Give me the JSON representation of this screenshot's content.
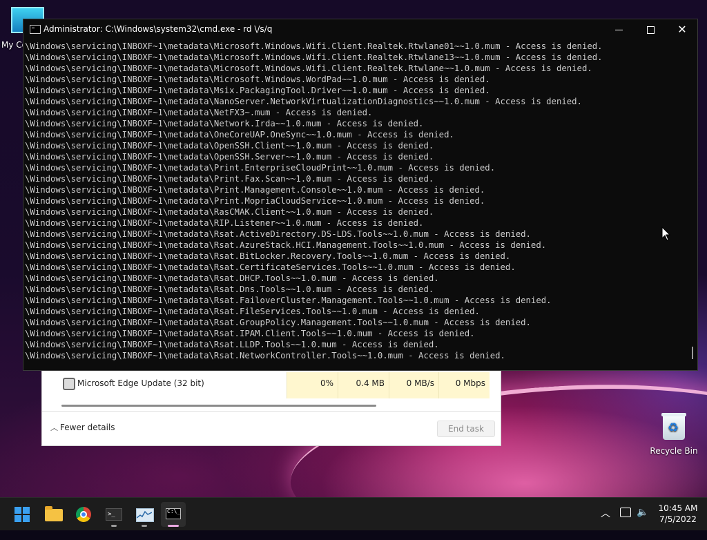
{
  "desktop": {
    "my_computer_label": "My Co",
    "recycle_bin_label": "Recycle Bin"
  },
  "task_manager": {
    "process_name": "Microsoft Edge Update (32 bit)",
    "cpu": "0%",
    "memory": "0.4 MB",
    "disk": "0 MB/s",
    "network": "0 Mbps",
    "fewer_details_label": "Fewer details",
    "end_task_label": "End task"
  },
  "cmd_window": {
    "title": "Administrator: C:\\Windows\\system32\\cmd.exe - rd \\/s/q",
    "lines": [
      "\\Windows\\servicing\\INBOXF~1\\metadata\\Microsoft.Windows.Wifi.Client.Realtek.Rtwlane01~~1.0.mum - Access is denied.",
      "\\Windows\\servicing\\INBOXF~1\\metadata\\Microsoft.Windows.Wifi.Client.Realtek.Rtwlane13~~1.0.mum - Access is denied.",
      "\\Windows\\servicing\\INBOXF~1\\metadata\\Microsoft.Windows.Wifi.Client.Realtek.Rtwlane~~1.0.mum - Access is denied.",
      "\\Windows\\servicing\\INBOXF~1\\metadata\\Microsoft.Windows.WordPad~~1.0.mum - Access is denied.",
      "\\Windows\\servicing\\INBOXF~1\\metadata\\Msix.PackagingTool.Driver~~1.0.mum - Access is denied.",
      "\\Windows\\servicing\\INBOXF~1\\metadata\\NanoServer.NetworkVirtualizationDiagnostics~~1.0.mum - Access is denied.",
      "\\Windows\\servicing\\INBOXF~1\\metadata\\NetFX3~.mum - Access is denied.",
      "\\Windows\\servicing\\INBOXF~1\\metadata\\Network.Irda~~1.0.mum - Access is denied.",
      "\\Windows\\servicing\\INBOXF~1\\metadata\\OneCoreUAP.OneSync~~1.0.mum - Access is denied.",
      "\\Windows\\servicing\\INBOXF~1\\metadata\\OpenSSH.Client~~1.0.mum - Access is denied.",
      "\\Windows\\servicing\\INBOXF~1\\metadata\\OpenSSH.Server~~1.0.mum - Access is denied.",
      "\\Windows\\servicing\\INBOXF~1\\metadata\\Print.EnterpriseCloudPrint~~1.0.mum - Access is denied.",
      "\\Windows\\servicing\\INBOXF~1\\metadata\\Print.Fax.Scan~~1.0.mum - Access is denied.",
      "\\Windows\\servicing\\INBOXF~1\\metadata\\Print.Management.Console~~1.0.mum - Access is denied.",
      "\\Windows\\servicing\\INBOXF~1\\metadata\\Print.MopriaCloudService~~1.0.mum - Access is denied.",
      "\\Windows\\servicing\\INBOXF~1\\metadata\\RasCMAK.Client~~1.0.mum - Access is denied.",
      "\\Windows\\servicing\\INBOXF~1\\metadata\\RIP.Listener~~1.0.mum - Access is denied.",
      "\\Windows\\servicing\\INBOXF~1\\metadata\\Rsat.ActiveDirectory.DS-LDS.Tools~~1.0.mum - Access is denied.",
      "\\Windows\\servicing\\INBOXF~1\\metadata\\Rsat.AzureStack.HCI.Management.Tools~~1.0.mum - Access is denied.",
      "\\Windows\\servicing\\INBOXF~1\\metadata\\Rsat.BitLocker.Recovery.Tools~~1.0.mum - Access is denied.",
      "\\Windows\\servicing\\INBOXF~1\\metadata\\Rsat.CertificateServices.Tools~~1.0.mum - Access is denied.",
      "\\Windows\\servicing\\INBOXF~1\\metadata\\Rsat.DHCP.Tools~~1.0.mum - Access is denied.",
      "\\Windows\\servicing\\INBOXF~1\\metadata\\Rsat.Dns.Tools~~1.0.mum - Access is denied.",
      "\\Windows\\servicing\\INBOXF~1\\metadata\\Rsat.FailoverCluster.Management.Tools~~1.0.mum - Access is denied.",
      "\\Windows\\servicing\\INBOXF~1\\metadata\\Rsat.FileServices.Tools~~1.0.mum - Access is denied.",
      "\\Windows\\servicing\\INBOXF~1\\metadata\\Rsat.GroupPolicy.Management.Tools~~1.0.mum - Access is denied.",
      "\\Windows\\servicing\\INBOXF~1\\metadata\\Rsat.IPAM.Client.Tools~~1.0.mum - Access is denied.",
      "\\Windows\\servicing\\INBOXF~1\\metadata\\Rsat.LLDP.Tools~~1.0.mum - Access is denied.",
      "\\Windows\\servicing\\INBOXF~1\\metadata\\Rsat.NetworkController.Tools~~1.0.mum - Access is denied."
    ]
  },
  "taskbar": {
    "apps": [
      "start",
      "file-explorer",
      "chrome",
      "terminal",
      "task-manager",
      "cmd"
    ],
    "time": "10:45 AM",
    "date": "7/5/2022",
    "colors": {
      "taskbar_bg": "#1c1c1c",
      "accent": "#3aa0f0",
      "active_indicator": "#e8a8e0"
    }
  }
}
